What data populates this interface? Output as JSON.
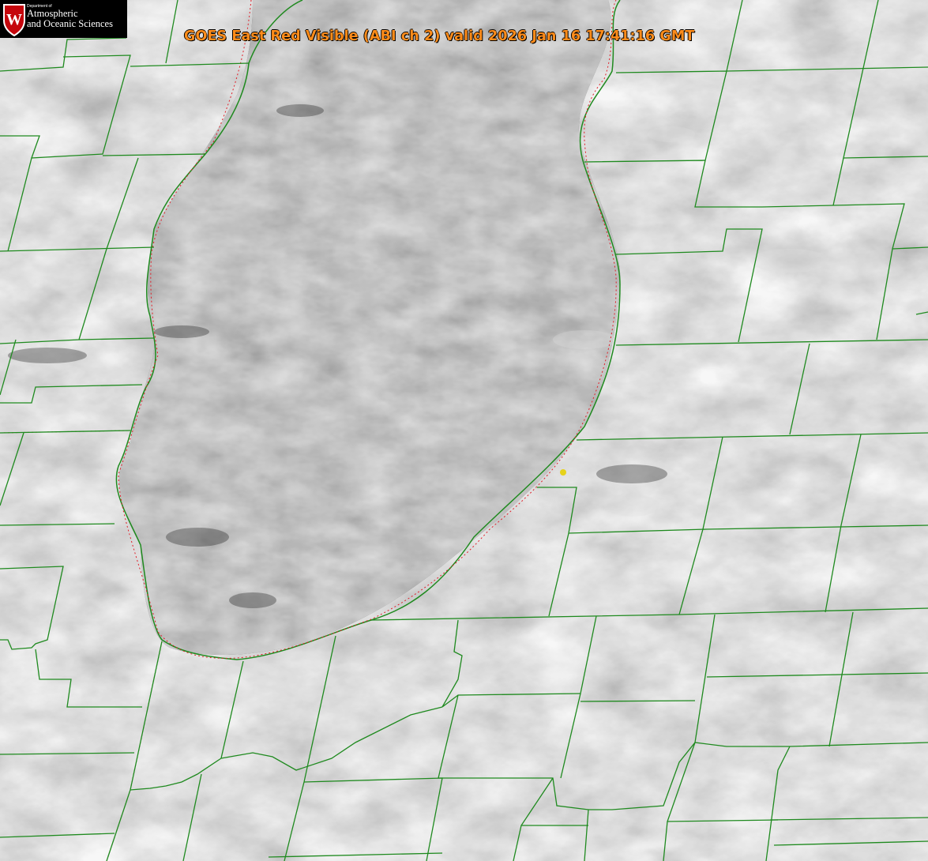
{
  "header": {
    "title": "GOES East Red Visible (ABI ch 2) valid 2026 Jan 16 17:41:16 GMT"
  },
  "logo": {
    "letter": "W",
    "department": "Department of",
    "line1": "Atmospheric",
    "line2": "and Oceanic Sciences"
  },
  "colors": {
    "title": "#ff8c1a",
    "county_lines": "#1f8a1f",
    "border_dotted": "#e0202a",
    "station_marker": "#e6d21a",
    "logo_red": "#c5050c"
  },
  "icons": {
    "logo": "uw-crest-icon",
    "marker": "station-dot-icon"
  }
}
